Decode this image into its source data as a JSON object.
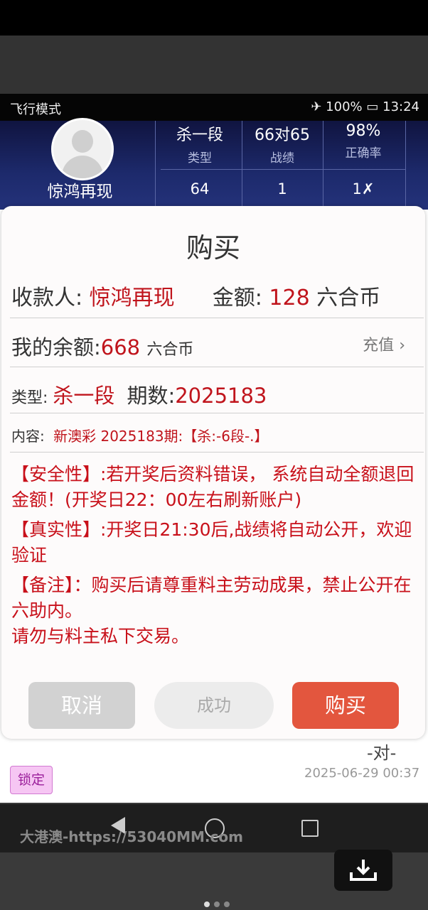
{
  "status_bar": {
    "left": "飞行模式",
    "battery": "100%",
    "time": "13:24"
  },
  "profile": {
    "username": "惊鸿再现",
    "stats": [
      {
        "value": "杀一段",
        "label": "类型"
      },
      {
        "value": "66对65",
        "label": "战绩"
      },
      {
        "value": "98%",
        "label": "正确率"
      }
    ],
    "row2": [
      "64",
      "1",
      "1✗"
    ]
  },
  "dialog": {
    "title": "购买",
    "payee_label": "收款人:",
    "payee": "惊鸿再现",
    "amount_label": "金额:",
    "amount": "128",
    "currency": "六合币",
    "balance_label": "我的余额:",
    "balance": "668",
    "recharge": "充值",
    "type_label": "类型:",
    "type_value": "杀一段",
    "period_label": "期数:",
    "period_value": "2025183",
    "content_label": "内容:",
    "content_value": "新澳彩 2025183期:【杀:-6段-.】",
    "notes": [
      "【安全性】:若开奖后资料错误， 系统自动全额退回金额！(开奖日22：00左右刷新账户)",
      "【真实性】:开奖日21:30后,战绩将自动公开，欢迎 验证",
      "【备注】：购买后请尊重料主劳动成果，禁止公开在六助内。",
      "请勿与料主私下交易。"
    ],
    "cancel": "取消",
    "success": "成功",
    "buy": "购买"
  },
  "underlying": {
    "lock": "锁定",
    "result": "-对-",
    "date": "2025-06-29 00:37"
  },
  "watermark": "大港澳-https://53040MM.com",
  "colors": {
    "accent_red": "#c0141c",
    "buy_button": "#e3563e",
    "header_bg": "#1d2a6c"
  }
}
